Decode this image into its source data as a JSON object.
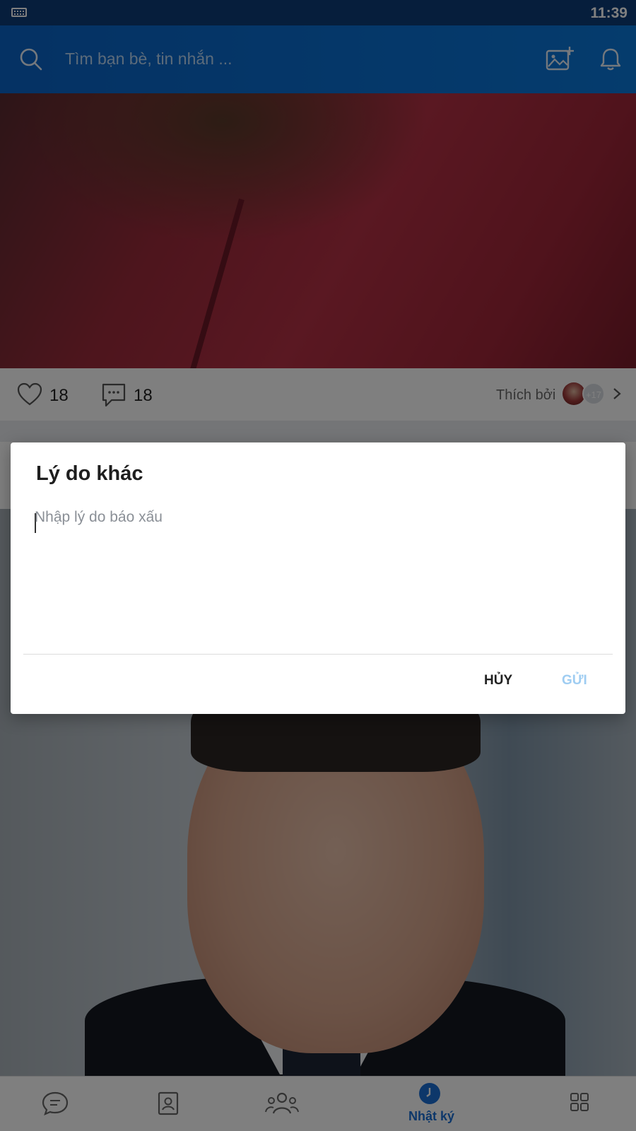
{
  "status_bar": {
    "time": "11:39"
  },
  "header": {
    "search_placeholder": "Tìm bạn bè, tin nhắn ...",
    "accent_color": "#0b6fd6"
  },
  "post": {
    "likes": "18",
    "comments": "18",
    "liked_by_label": "Thích bởi",
    "more_likers": "+17"
  },
  "dialog": {
    "title": "Lý do khác",
    "input_placeholder": "Nhập lý do báo xấu",
    "input_value": "",
    "cancel_label": "HỦY",
    "send_label": "GỬI"
  },
  "bottom_nav": {
    "active_label": "Nhật ký",
    "items": [
      "message-icon",
      "contacts-icon",
      "groups-icon",
      "timeline-icon",
      "more-apps-icon"
    ]
  }
}
